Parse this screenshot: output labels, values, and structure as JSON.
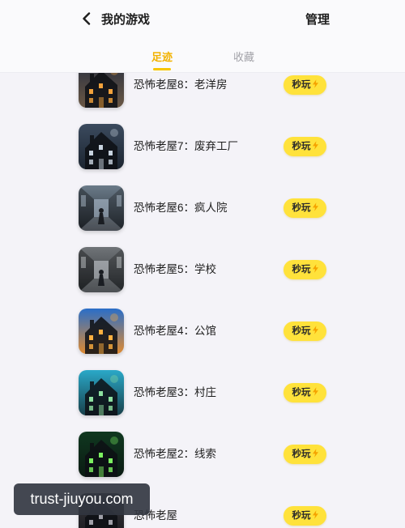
{
  "header": {
    "back_icon": "chevron-left-icon",
    "title": "我的游戏",
    "manage_label": "管理"
  },
  "tabs": [
    {
      "label": "足迹",
      "active": true
    },
    {
      "label": "收藏",
      "active": false
    }
  ],
  "colors": {
    "background": "#f4f3f8",
    "header_background": "#fafafc",
    "text": "#1e1e1e",
    "active_tab": "#f2b200",
    "inactive_tab": "#a2a2a8",
    "tab_indicator": "#f7c600",
    "play_button": "#ffe23b",
    "lightning": "#f5a300",
    "watermark_background": "#323640"
  },
  "games": [
    {
      "title": "恐怖老屋8：老洋房",
      "play_label": "秒玩",
      "icon": "old-mansion-icon",
      "icon_colors": [
        "#2b3140",
        "#6a5744",
        "#f2a23c"
      ]
    },
    {
      "title": "恐怖老屋7：废弃工厂",
      "play_label": "秒玩",
      "icon": "abandoned-factory-icon",
      "icon_colors": [
        "#3b4a5e",
        "#1c2530",
        "#c8d4e0"
      ]
    },
    {
      "title": "恐怖老屋6：疯人院",
      "play_label": "秒玩",
      "icon": "asylum-corridor-icon",
      "icon_colors": [
        "#6a7a88",
        "#2a3038",
        "#b8c8d8"
      ]
    },
    {
      "title": "恐怖老屋5：学校",
      "play_label": "秒玩",
      "icon": "school-corridor-icon",
      "icon_colors": [
        "#707478",
        "#2e3236",
        "#d0d4d8"
      ]
    },
    {
      "title": "恐怖老屋4：公馆",
      "play_label": "秒玩",
      "icon": "manor-icon",
      "icon_colors": [
        "#2a6ec8",
        "#e08a30",
        "#ffb040"
      ]
    },
    {
      "title": "恐怖老屋3：村庄",
      "play_label": "秒玩",
      "icon": "village-house-icon",
      "icon_colors": [
        "#2aa8c8",
        "#18404a",
        "#8de0a0"
      ]
    },
    {
      "title": "恐怖老屋2：线索",
      "play_label": "秒玩",
      "icon": "glowing-house-icon",
      "icon_colors": [
        "#103820",
        "#0a1a12",
        "#7cf060"
      ]
    },
    {
      "title": "恐怖老屋",
      "play_label": "秒玩",
      "icon": "haunted-house-icon",
      "icon_colors": [
        "#3a3a40",
        "#18181c",
        "#a0a0a8"
      ]
    }
  ],
  "watermark": {
    "text": "trust-jiuyou.com"
  }
}
